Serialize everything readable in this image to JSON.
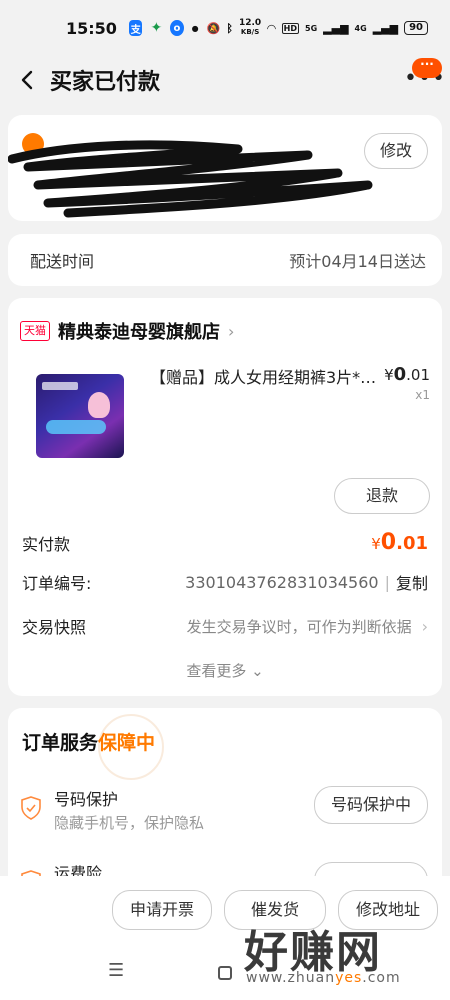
{
  "status_bar": {
    "time": "15:50",
    "net_speed_value": "12.0",
    "net_speed_unit": "KB/S",
    "signal_1": "5G",
    "signal_2": "4G",
    "battery": "90",
    "hd_label": "HD"
  },
  "header": {
    "title": "买家已付款",
    "message_badge": "···"
  },
  "address": {
    "edit_label": "修改"
  },
  "delivery": {
    "label": "配送时间",
    "value": "预计04月14日送达"
  },
  "order": {
    "shop_badge": "天猫",
    "shop_name": "精典泰迪母婴旗舰店",
    "product": {
      "title": "【赠品】成人女用经期裤3片*…",
      "price_symbol": "¥",
      "price_int": "0",
      "price_dec": ".01",
      "quantity": "x1"
    },
    "refund_label": "退款",
    "paid_label": "实付款",
    "paid_symbol": "¥",
    "paid_int": "0",
    "paid_dec": ".01",
    "order_no_label": "订单编号:",
    "order_no": "3301043762831034560",
    "copy_label": "复制",
    "snapshot_label": "交易快照",
    "snapshot_value": "发生交易争议时，可作为判断依据",
    "see_more": "查看更多"
  },
  "service": {
    "title": "订单服务",
    "status": "保障中",
    "items": [
      {
        "title": "号码保护",
        "desc": "隐藏手机号，保护隐私",
        "button": "号码保护中"
      },
      {
        "title": "运费险"
      }
    ]
  },
  "bottom_bar": {
    "invoice": "申请开票",
    "urge": "催发货",
    "change_address": "修改地址"
  },
  "watermark": {
    "logo": "好赚网",
    "url_prefix": "www.zhuan",
    "url_accent": "yes",
    "url_suffix": ".com"
  }
}
